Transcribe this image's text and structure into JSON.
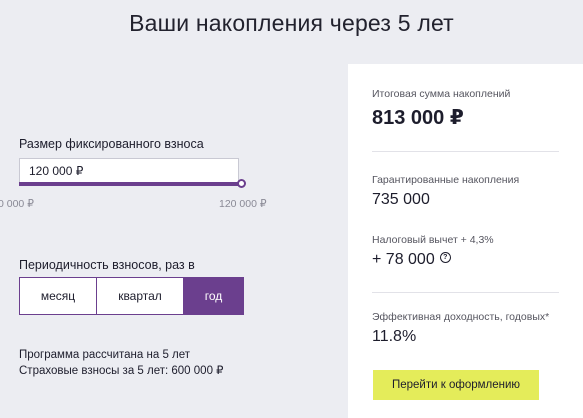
{
  "page": {
    "title": "Ваши накопления через 5 лет"
  },
  "contribution": {
    "label": "Размер фиксированного взноса",
    "value": "120 000 ₽",
    "slider_min": "0 000 ₽",
    "slider_max": "120 000 ₽",
    "slider_fraction": 1.0
  },
  "frequency": {
    "label": "Периодичность взносов, раз в",
    "options": [
      "месяц",
      "квартал",
      "год"
    ],
    "selected": "год"
  },
  "note": {
    "line1": "Программа рассчитана на 5 лет",
    "line2": "Страховые взносы за 5 лет: 600 000 ₽"
  },
  "summary": {
    "total_label": "Итоговая сумма накоплений",
    "total_value": "813 000 ₽",
    "guaranteed_label": "Гарантированные накопления",
    "guaranteed_value": "735 000",
    "tax_label": "Налоговый вычет + 4,3%",
    "tax_value": "+ 78 000",
    "yield_label": "Эффективная доходность, годовых*",
    "yield_value": "11.8%",
    "cta_label": "Перейти к оформлению"
  },
  "colors": {
    "accent": "#6b3f8e",
    "cta": "#e4ec5a",
    "background": "#ecedf2"
  }
}
